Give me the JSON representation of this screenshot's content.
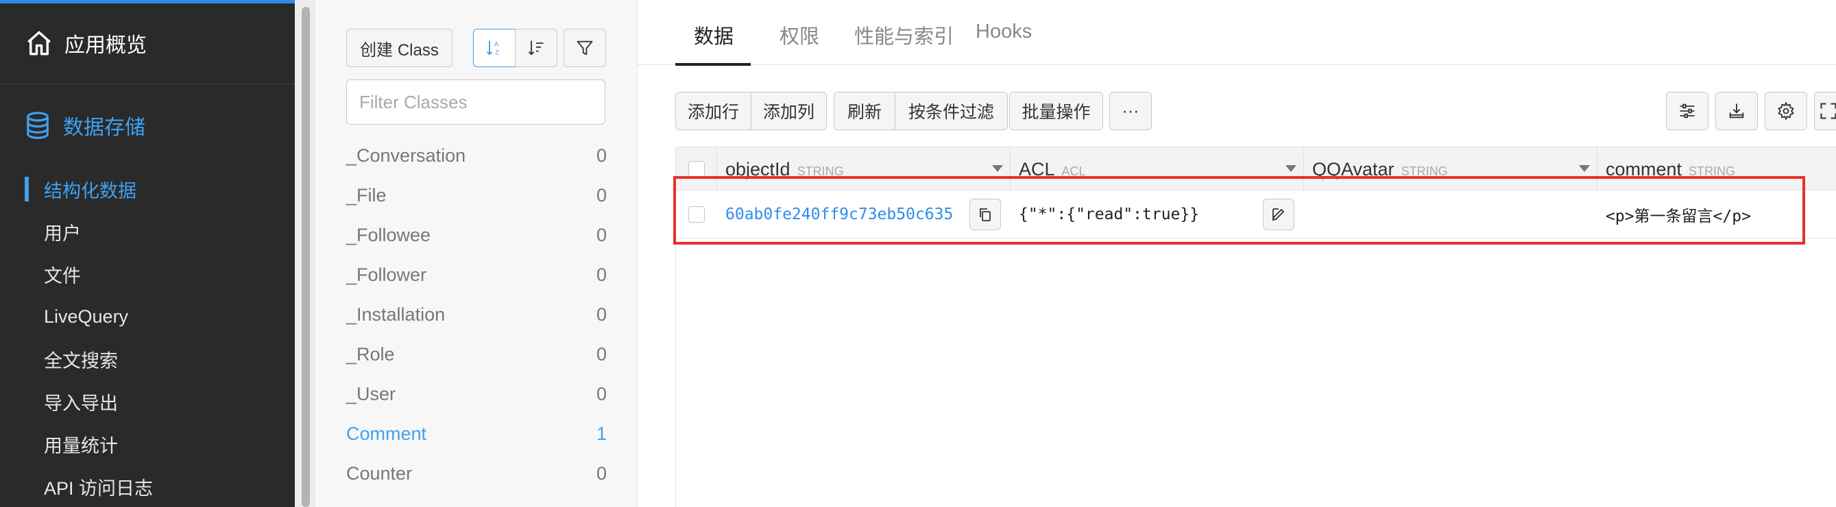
{
  "sidebar": {
    "overview_label": "应用概览",
    "storage_label": "数据存储",
    "items": [
      {
        "label": "结构化数据",
        "active": true
      },
      {
        "label": "用户"
      },
      {
        "label": "文件"
      },
      {
        "label": "LiveQuery"
      },
      {
        "label": "全文搜索"
      },
      {
        "label": "导入导出"
      },
      {
        "label": "用量统计"
      },
      {
        "label": "API 访问日志"
      }
    ]
  },
  "class_panel": {
    "create_button": "创建 Class",
    "filter_placeholder": "Filter Classes",
    "classes": [
      {
        "name": "_Conversation",
        "count": "0"
      },
      {
        "name": "_File",
        "count": "0"
      },
      {
        "name": "_Followee",
        "count": "0"
      },
      {
        "name": "_Follower",
        "count": "0"
      },
      {
        "name": "_Installation",
        "count": "0"
      },
      {
        "name": "_Role",
        "count": "0"
      },
      {
        "name": "_User",
        "count": "0"
      },
      {
        "name": "Comment",
        "count": "1",
        "active": true
      },
      {
        "name": "Counter",
        "count": "0"
      }
    ]
  },
  "tabs": [
    "数据",
    "权限",
    "性能与索引",
    "Hooks"
  ],
  "toolbar": {
    "add_row": "添加行",
    "add_column": "添加列",
    "refresh": "刷新",
    "filter": "按条件过滤",
    "batch": "批量操作",
    "more": "···"
  },
  "table": {
    "columns": [
      {
        "name": "objectId",
        "type": "STRING"
      },
      {
        "name": "ACL",
        "type": "ACL"
      },
      {
        "name": "QQAvatar",
        "type": "STRING"
      },
      {
        "name": "comment",
        "type": "STRING"
      }
    ],
    "rows": [
      {
        "objectId": "60ab0fe240ff9c73eb50c635",
        "ACL": "{\"*\":{\"read\":true}}",
        "QQAvatar": "",
        "comment": "<p>第一条留言</p>"
      }
    ]
  },
  "colors": {
    "accent": "#3ea1f2",
    "sidebar_bg": "#2a2a2a",
    "highlight": "#e8302a"
  }
}
